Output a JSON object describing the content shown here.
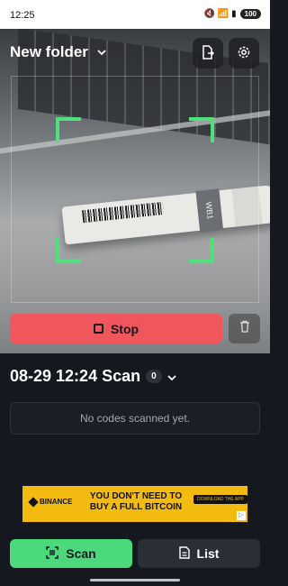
{
  "status_bar": {
    "time": "12:25",
    "icons": "🔇 📶 ▮",
    "battery": "100"
  },
  "header": {
    "folder_name": "New folder",
    "export_icon": "export-file-icon",
    "settings_icon": "gear-icon"
  },
  "camera": {
    "pen_label": "WB1"
  },
  "controls": {
    "stop_label": "Stop"
  },
  "session": {
    "title": "08-29 12:24 Scan",
    "count": "0",
    "empty_text": "No codes scanned yet."
  },
  "ad": {
    "brand": "BINANCE",
    "headline": "YOU DON'T NEED TO BUY A FULL BITCOIN",
    "cta": "DOWNLOAD THE APP"
  },
  "tabs": [
    {
      "label": "Scan"
    },
    {
      "label": "List"
    }
  ],
  "colors": {
    "accent": "#4cd97b",
    "danger": "#f0575c",
    "background": "#15191f"
  }
}
